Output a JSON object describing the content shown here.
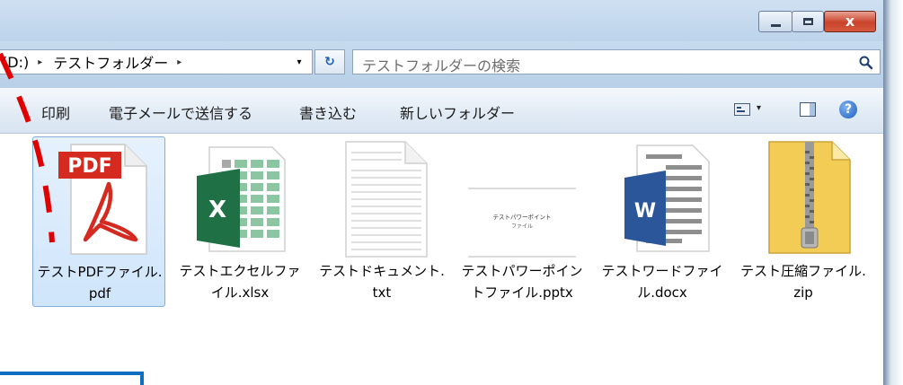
{
  "titlebar": {
    "minimize_icon": "minimize-icon",
    "maximize_icon": "maximize-icon",
    "close_icon": "close-icon",
    "close_symbol": "x"
  },
  "address": {
    "drive": "(D:)",
    "folder": "テストフォルダー",
    "separator": "▸",
    "dropdown": "▾",
    "refresh_symbol": "↻"
  },
  "search": {
    "placeholder": "テストフォルダーの検索"
  },
  "toolbar": {
    "print": "印刷",
    "email": "電子メールで送信する",
    "burn": "書き込む",
    "new_folder": "新しいフォルダー",
    "view_dropdown": "▾",
    "help": "?"
  },
  "files": [
    {
      "label": "テストPDFファイル.pdf",
      "icon": "pdf-file-icon",
      "selected": true
    },
    {
      "label": "テストエクセルファイル.xlsx",
      "icon": "excel-file-icon",
      "selected": false
    },
    {
      "label": "テストドキュメント.txt",
      "icon": "text-file-icon",
      "selected": false
    },
    {
      "label": "テストパワーポイントファイル.pptx",
      "icon": "powerpoint-file-icon",
      "selected": false
    },
    {
      "label": "テストワードファイル.docx",
      "icon": "word-file-icon",
      "selected": false
    },
    {
      "label": "テスト圧縮ファイル.zip",
      "icon": "zip-file-icon",
      "selected": false
    }
  ],
  "thumbnails": {
    "pdf_badge": "PDF",
    "excel_letter": "X",
    "word_letter": "W",
    "pptx_slide_title": "テストパワーポイント",
    "pptx_slide_subtitle": "ファイル"
  },
  "colors": {
    "pdf_red": "#d42a20",
    "excel_green": "#1f7145",
    "word_blue": "#2b579a",
    "zip_yellow": "#f2cc55",
    "selection": "#cfe5fb",
    "annotation_red": "#e00000",
    "annotation_blue": "#0f6fbf"
  }
}
